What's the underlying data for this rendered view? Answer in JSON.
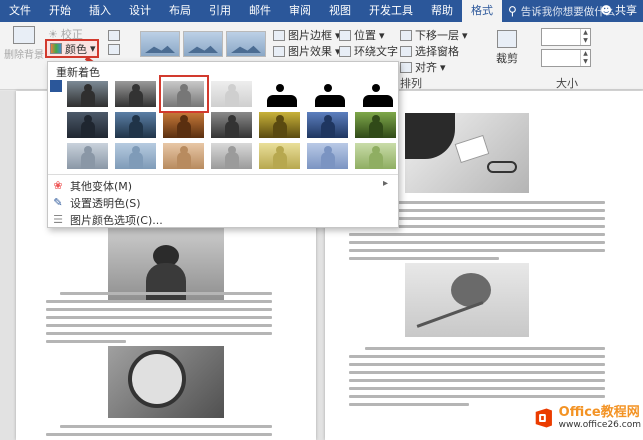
{
  "tabs": [
    "文件",
    "开始",
    "插入",
    "设计",
    "布局",
    "引用",
    "邮件",
    "审阅",
    "视图",
    "开发工具",
    "帮助",
    "格式"
  ],
  "active_tab": "格式",
  "tell_me": "告诉我你想要做什么",
  "share": "共享",
  "ribbon": {
    "remove_bg": "删除背景",
    "corrections": "校正",
    "color": "颜色",
    "picture_border": "图片边框",
    "picture_effects": "图片效果",
    "position": "位置",
    "wrap_text": "环绕文字",
    "bring_forward": "下移一层",
    "selection_pane": "选择窗格",
    "align": "对齐",
    "crop": "裁剪",
    "arrange_group": "排列",
    "size_group": "大小"
  },
  "dropdown": {
    "recolor_title": "重新着色",
    "more_variations": "其他变体(M)",
    "set_transparent": "设置透明色(S)",
    "picture_color_options": "图片颜色选项(C)..."
  },
  "watermark": {
    "brand": "Office教程网",
    "url": "www.office26.com"
  }
}
